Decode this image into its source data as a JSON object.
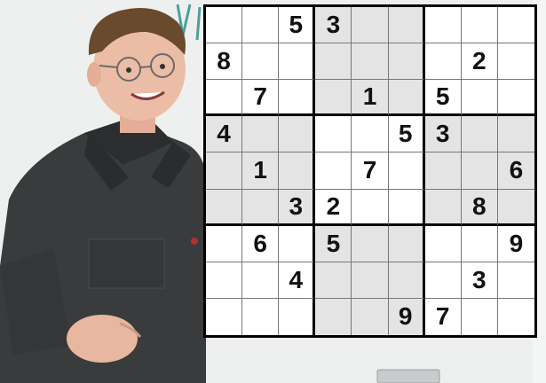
{
  "puzzle": {
    "grid": [
      [
        "",
        "",
        "5",
        "3",
        "",
        "",
        "",
        "",
        ""
      ],
      [
        "8",
        "",
        "",
        "",
        "",
        "",
        "",
        "2",
        ""
      ],
      [
        "",
        "7",
        "",
        "",
        "1",
        "",
        "5",
        "",
        ""
      ],
      [
        "4",
        "",
        "",
        "",
        "",
        "5",
        "3",
        "",
        ""
      ],
      [
        "",
        "1",
        "",
        "",
        "7",
        "",
        "",
        "",
        "6"
      ],
      [
        "",
        "",
        "3",
        "2",
        "",
        "",
        "",
        "8",
        ""
      ],
      [
        "",
        "6",
        "",
        "5",
        "",
        "",
        "",
        "",
        "9"
      ],
      [
        "",
        "",
        "4",
        "",
        "",
        "",
        "",
        "3",
        ""
      ],
      [
        "",
        "",
        "",
        "",
        "",
        "9",
        "7",
        "",
        ""
      ]
    ],
    "shaded_boxes": [
      "top-middle",
      "middle-left",
      "middle-right",
      "bottom-middle"
    ]
  },
  "colors": {
    "board_background": "#ffffff",
    "shaded_cell": "#e4e4e4",
    "board_lines": "#000000",
    "digits": "#111111"
  }
}
